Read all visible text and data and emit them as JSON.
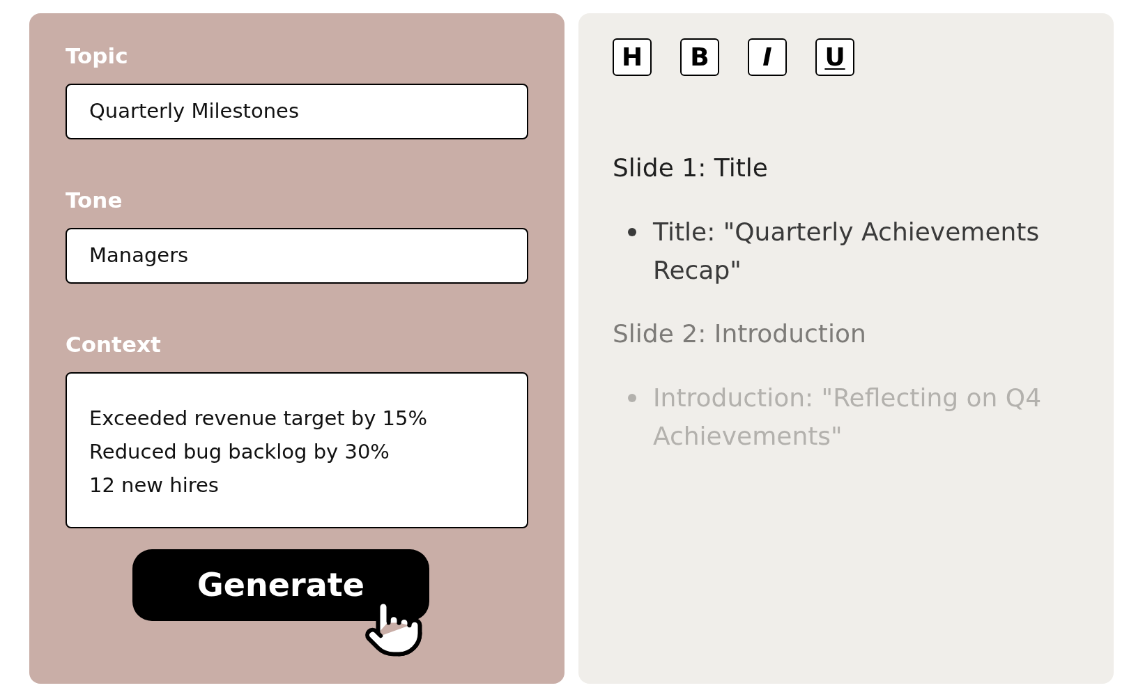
{
  "form": {
    "fields": [
      {
        "label": "Topic",
        "value": "Quarterly Milestones",
        "kind": "input"
      },
      {
        "label": "Tone",
        "value": "Managers",
        "kind": "input"
      },
      {
        "label": "Context",
        "value": "Exceeded revenue target by 15%\nReduced bug backlog by 30%\n12 new hires",
        "kind": "textarea"
      }
    ],
    "button": "Generate"
  },
  "toolbar": [
    {
      "label": "H",
      "kind": "heading"
    },
    {
      "label": "B",
      "kind": "bold"
    },
    {
      "label": "I",
      "kind": "italic"
    },
    {
      "label": "U",
      "kind": "underline"
    }
  ],
  "preview": [
    {
      "kind": "heading",
      "text": "Slide 1: Title"
    },
    {
      "kind": "bullet",
      "text": "Title: \"Quarterly Achievements Recap\""
    },
    {
      "kind": "heading",
      "text": "Slide 2: Introduction"
    },
    {
      "kind": "bullet",
      "text": "Introduction: \"Reflecting on Q4 Achievements\""
    }
  ]
}
